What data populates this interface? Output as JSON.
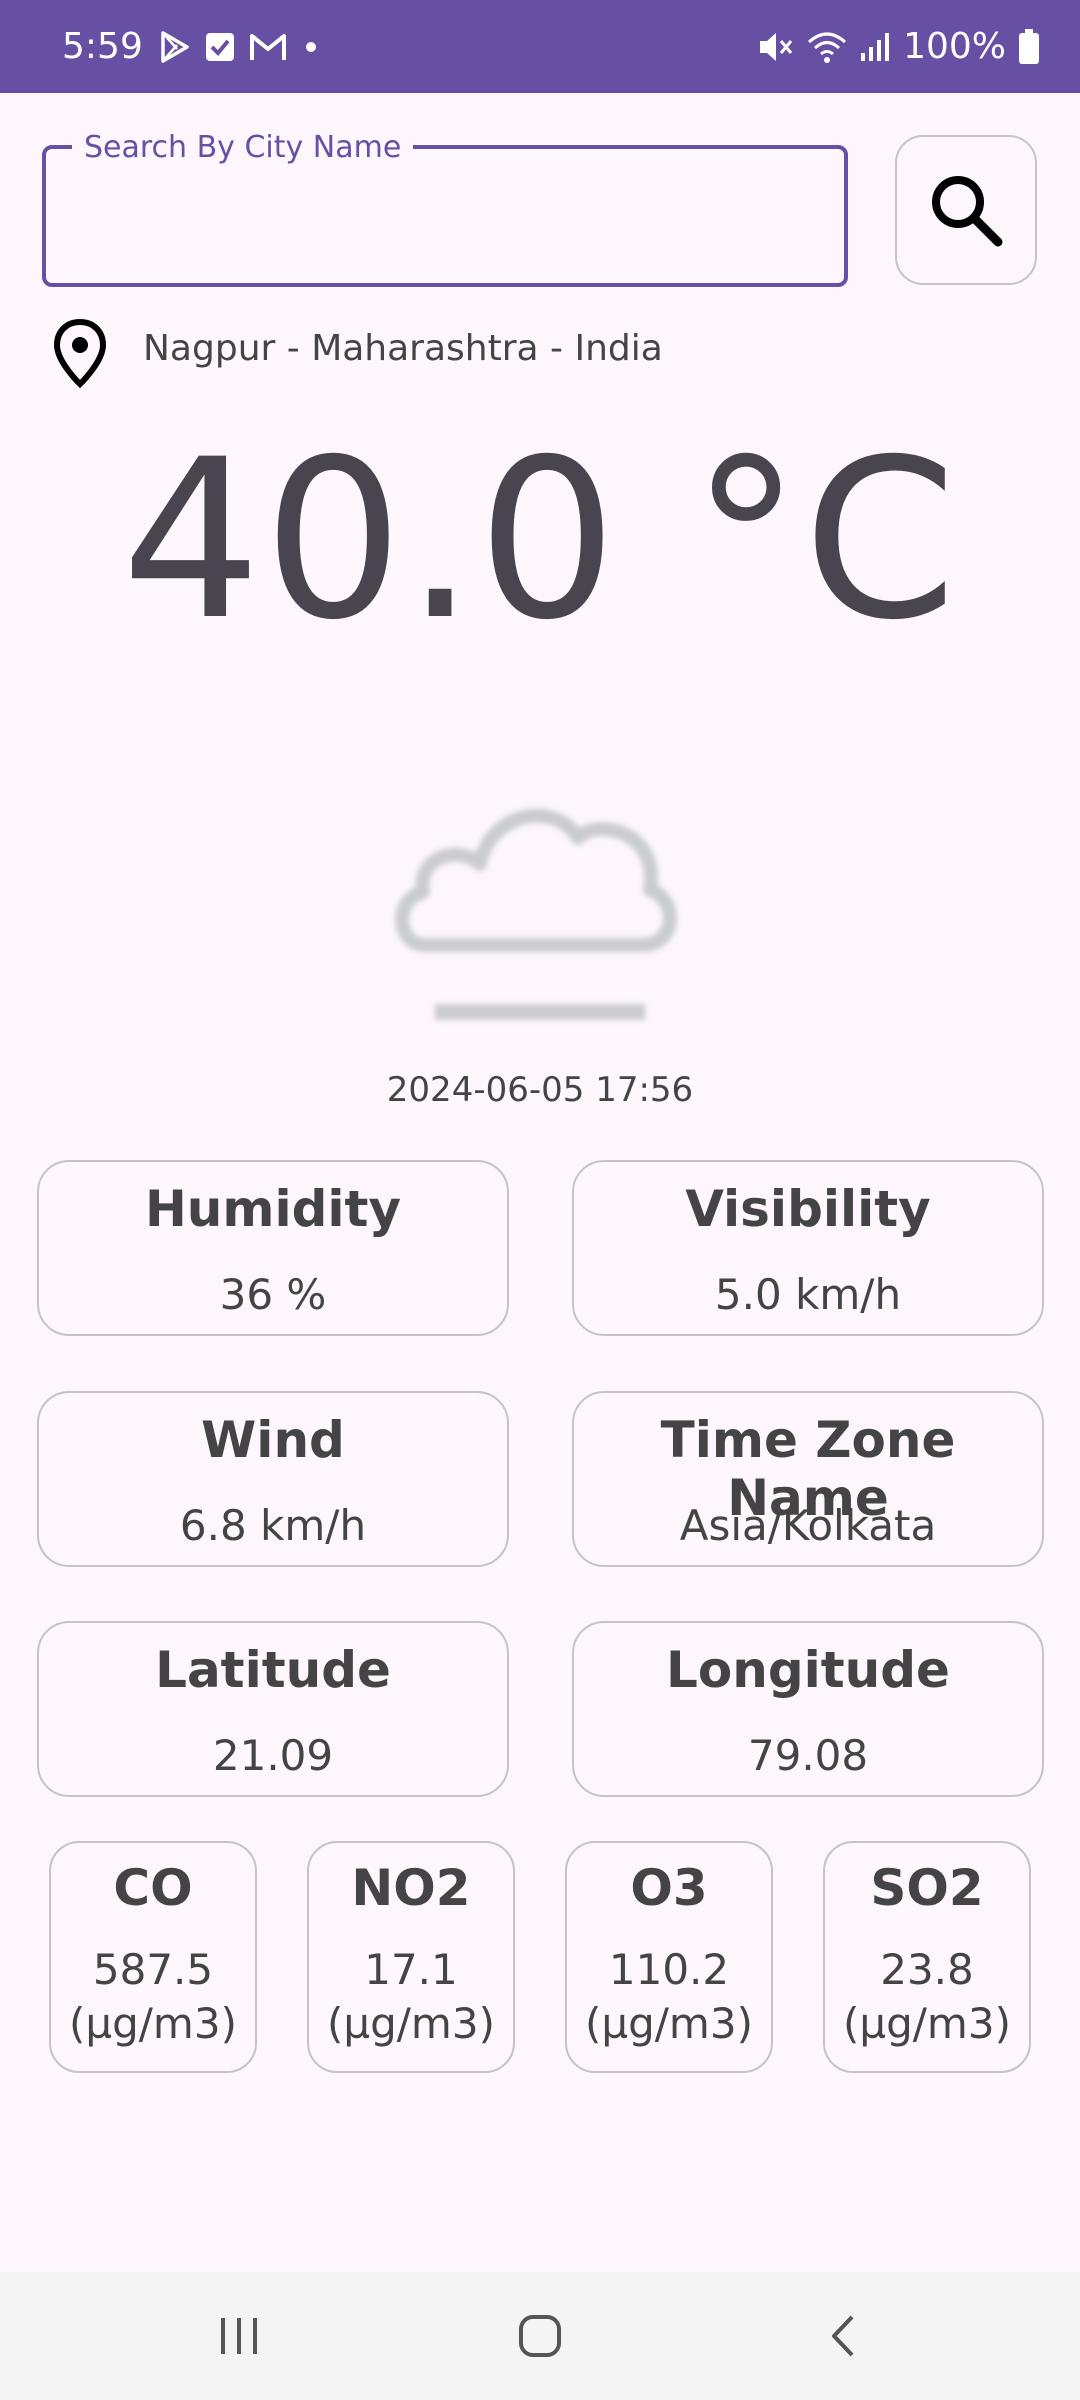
{
  "status_bar": {
    "time": "5:59",
    "battery": "100%",
    "left_icons": [
      "play-store-icon",
      "check-icon",
      "gmail-icon",
      "dot-icon"
    ],
    "right_icons": [
      "mute-icon",
      "wifi-icon",
      "signal-icon",
      "battery-icon"
    ]
  },
  "search": {
    "label": "Search By City Name",
    "value": "",
    "placeholder": ""
  },
  "location": {
    "text": "Nagpur - Maharashtra - India"
  },
  "temperature": "40.0 °C",
  "weather_icon": "cloudy-icon",
  "datetime": "2024-06-05 17:56",
  "cards": [
    {
      "title": "Humidity",
      "value": "36 %"
    },
    {
      "title": "Visibility",
      "value": "5.0 km/h"
    },
    {
      "title": "Wind",
      "value": "6.8 km/h"
    },
    {
      "title": "Time Zone Name",
      "value": "Asia/Kolkata"
    },
    {
      "title": "Latitude",
      "value": "21.09"
    },
    {
      "title": "Longitude",
      "value": "79.08"
    }
  ],
  "air_quality": [
    {
      "title": "CO",
      "value": "587.5",
      "unit": "(µg/m3)"
    },
    {
      "title": "NO2",
      "value": "17.1",
      "unit": "(µg/m3)"
    },
    {
      "title": "O3",
      "value": "110.2",
      "unit": "(µg/m3)"
    },
    {
      "title": "SO2",
      "value": "23.8",
      "unit": "(µg/m3)"
    }
  ],
  "colors": {
    "accent": "#6750a4",
    "background": "#fdf7fd",
    "card_border": "#c8c2c8"
  }
}
